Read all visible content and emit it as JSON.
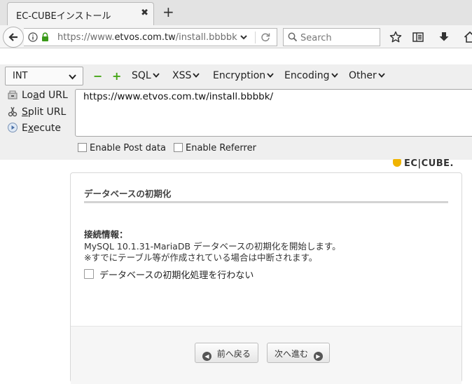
{
  "browser": {
    "tab_title": "EC-CUBEインストール",
    "tab_close": "✖",
    "new_tab": "+",
    "url_prefix": "https://www.",
    "url_domain": "etvos.com.tw",
    "url_suffix": "/install.bbbbk",
    "search_placeholder": "Search"
  },
  "hackbar": {
    "select_value": "INT",
    "minus": "−",
    "plus": "+",
    "menus": [
      "SQL",
      "XSS",
      "Encryption",
      "Encoding",
      "Other"
    ],
    "load_url": {
      "pre": "Lo",
      "u": "a",
      "post": "d URL"
    },
    "split_url": {
      "pre": "",
      "u": "S",
      "post": "plit URL"
    },
    "execute": {
      "pre": "E",
      "u": "x",
      "post": "ecute"
    },
    "url_text": "https://www.etvos.com.tw/install.bbbbk/",
    "enable_post": "Enable Post data",
    "enable_referrer": "Enable Referrer"
  },
  "page": {
    "logo_text": "EC|CUBE.",
    "heading": "データベースの初期化",
    "conn_label": "接続情報：",
    "conn_line1": "MySQL 10.1.31-MariaDB データベースの初期化を開始します。",
    "conn_line2": "※すでにテーブル等が作成されている場合は中断されます。",
    "skip_label": "データベースの初期化処理を行わない",
    "back_button": "前へ戻る",
    "next_button": "次へ進む"
  }
}
